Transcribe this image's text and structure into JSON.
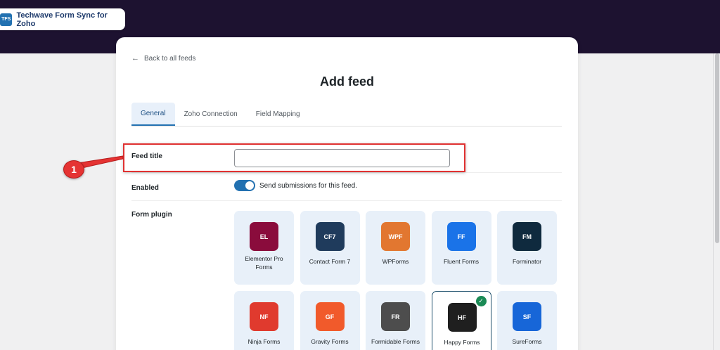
{
  "brand": {
    "logo": "TFS",
    "name": "Techwave Form Sync for Zoho"
  },
  "back_link": {
    "icon": "arrow-left-icon",
    "label": "Back to all feeds"
  },
  "page_title": "Add feed",
  "tabs": [
    {
      "label": "General",
      "active": true
    },
    {
      "label": "Zoho Connection",
      "active": false
    },
    {
      "label": "Field Mapping",
      "active": false
    }
  ],
  "fields": {
    "feed_title": {
      "label": "Feed title",
      "value": "",
      "placeholder": ""
    },
    "enabled": {
      "label": "Enabled",
      "checked": true,
      "description": "Send submissions for this feed."
    },
    "form_plugin": {
      "label": "Form plugin"
    }
  },
  "plugins": [
    {
      "abbr": "EL",
      "name": "Elementor Pro Forms",
      "color": "#8a0c3c",
      "selected": false
    },
    {
      "abbr": "CF7",
      "name": "Contact Form 7",
      "color": "#1f3b5c",
      "selected": false
    },
    {
      "abbr": "WPF",
      "name": "WPForms",
      "color": "#e27730",
      "selected": false
    },
    {
      "abbr": "FF",
      "name": "Fluent Forms",
      "color": "#1a73e8",
      "selected": false
    },
    {
      "abbr": "FM",
      "name": "Forminator",
      "color": "#0f2a3e",
      "selected": false
    },
    {
      "abbr": "NF",
      "name": "Ninja Forms",
      "color": "#e03a2e",
      "selected": false
    },
    {
      "abbr": "GF",
      "name": "Gravity Forms",
      "color": "#f15a2b",
      "selected": false
    },
    {
      "abbr": "FR",
      "name": "Formidable Forms",
      "color": "#4d4d4d",
      "selected": false
    },
    {
      "abbr": "HF",
      "name": "Happy Forms",
      "color": "#1f1f1f",
      "selected": true
    },
    {
      "abbr": "SF",
      "name": "SureForms",
      "color": "#1766d8",
      "selected": false
    }
  ],
  "annotation": {
    "number": "1"
  }
}
